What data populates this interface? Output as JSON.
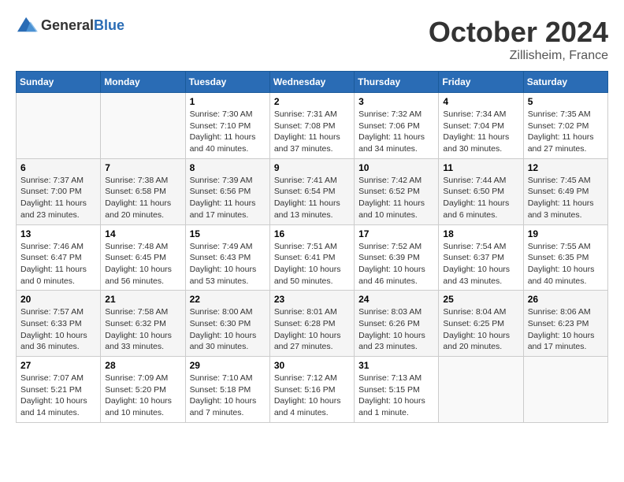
{
  "header": {
    "logo": {
      "text_general": "General",
      "text_blue": "Blue"
    },
    "title": "October 2024",
    "location": "Zillisheim, France"
  },
  "weekdays": [
    "Sunday",
    "Monday",
    "Tuesday",
    "Wednesday",
    "Thursday",
    "Friday",
    "Saturday"
  ],
  "weeks": [
    [
      {
        "day": null,
        "info": null
      },
      {
        "day": null,
        "info": null
      },
      {
        "day": "1",
        "sunrise": "7:30 AM",
        "sunset": "7:10 PM",
        "daylight": "11 hours and 40 minutes."
      },
      {
        "day": "2",
        "sunrise": "7:31 AM",
        "sunset": "7:08 PM",
        "daylight": "11 hours and 37 minutes."
      },
      {
        "day": "3",
        "sunrise": "7:32 AM",
        "sunset": "7:06 PM",
        "daylight": "11 hours and 34 minutes."
      },
      {
        "day": "4",
        "sunrise": "7:34 AM",
        "sunset": "7:04 PM",
        "daylight": "11 hours and 30 minutes."
      },
      {
        "day": "5",
        "sunrise": "7:35 AM",
        "sunset": "7:02 PM",
        "daylight": "11 hours and 27 minutes."
      }
    ],
    [
      {
        "day": "6",
        "sunrise": "7:37 AM",
        "sunset": "7:00 PM",
        "daylight": "11 hours and 23 minutes."
      },
      {
        "day": "7",
        "sunrise": "7:38 AM",
        "sunset": "6:58 PM",
        "daylight": "11 hours and 20 minutes."
      },
      {
        "day": "8",
        "sunrise": "7:39 AM",
        "sunset": "6:56 PM",
        "daylight": "11 hours and 17 minutes."
      },
      {
        "day": "9",
        "sunrise": "7:41 AM",
        "sunset": "6:54 PM",
        "daylight": "11 hours and 13 minutes."
      },
      {
        "day": "10",
        "sunrise": "7:42 AM",
        "sunset": "6:52 PM",
        "daylight": "11 hours and 10 minutes."
      },
      {
        "day": "11",
        "sunrise": "7:44 AM",
        "sunset": "6:50 PM",
        "daylight": "11 hours and 6 minutes."
      },
      {
        "day": "12",
        "sunrise": "7:45 AM",
        "sunset": "6:49 PM",
        "daylight": "11 hours and 3 minutes."
      }
    ],
    [
      {
        "day": "13",
        "sunrise": "7:46 AM",
        "sunset": "6:47 PM",
        "daylight": "11 hours and 0 minutes."
      },
      {
        "day": "14",
        "sunrise": "7:48 AM",
        "sunset": "6:45 PM",
        "daylight": "10 hours and 56 minutes."
      },
      {
        "day": "15",
        "sunrise": "7:49 AM",
        "sunset": "6:43 PM",
        "daylight": "10 hours and 53 minutes."
      },
      {
        "day": "16",
        "sunrise": "7:51 AM",
        "sunset": "6:41 PM",
        "daylight": "10 hours and 50 minutes."
      },
      {
        "day": "17",
        "sunrise": "7:52 AM",
        "sunset": "6:39 PM",
        "daylight": "10 hours and 46 minutes."
      },
      {
        "day": "18",
        "sunrise": "7:54 AM",
        "sunset": "6:37 PM",
        "daylight": "10 hours and 43 minutes."
      },
      {
        "day": "19",
        "sunrise": "7:55 AM",
        "sunset": "6:35 PM",
        "daylight": "10 hours and 40 minutes."
      }
    ],
    [
      {
        "day": "20",
        "sunrise": "7:57 AM",
        "sunset": "6:33 PM",
        "daylight": "10 hours and 36 minutes."
      },
      {
        "day": "21",
        "sunrise": "7:58 AM",
        "sunset": "6:32 PM",
        "daylight": "10 hours and 33 minutes."
      },
      {
        "day": "22",
        "sunrise": "8:00 AM",
        "sunset": "6:30 PM",
        "daylight": "10 hours and 30 minutes."
      },
      {
        "day": "23",
        "sunrise": "8:01 AM",
        "sunset": "6:28 PM",
        "daylight": "10 hours and 27 minutes."
      },
      {
        "day": "24",
        "sunrise": "8:03 AM",
        "sunset": "6:26 PM",
        "daylight": "10 hours and 23 minutes."
      },
      {
        "day": "25",
        "sunrise": "8:04 AM",
        "sunset": "6:25 PM",
        "daylight": "10 hours and 20 minutes."
      },
      {
        "day": "26",
        "sunrise": "8:06 AM",
        "sunset": "6:23 PM",
        "daylight": "10 hours and 17 minutes."
      }
    ],
    [
      {
        "day": "27",
        "sunrise": "7:07 AM",
        "sunset": "5:21 PM",
        "daylight": "10 hours and 14 minutes."
      },
      {
        "day": "28",
        "sunrise": "7:09 AM",
        "sunset": "5:20 PM",
        "daylight": "10 hours and 10 minutes."
      },
      {
        "day": "29",
        "sunrise": "7:10 AM",
        "sunset": "5:18 PM",
        "daylight": "10 hours and 7 minutes."
      },
      {
        "day": "30",
        "sunrise": "7:12 AM",
        "sunset": "5:16 PM",
        "daylight": "10 hours and 4 minutes."
      },
      {
        "day": "31",
        "sunrise": "7:13 AM",
        "sunset": "5:15 PM",
        "daylight": "10 hours and 1 minute."
      },
      {
        "day": null,
        "info": null
      },
      {
        "day": null,
        "info": null
      }
    ]
  ],
  "labels": {
    "sunrise_prefix": "Sunrise: ",
    "sunset_prefix": "Sunset: ",
    "daylight_prefix": "Daylight: "
  }
}
